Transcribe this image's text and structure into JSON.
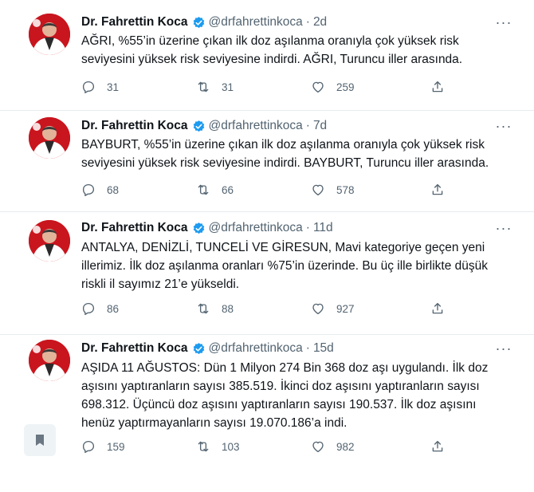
{
  "tweets": [
    {
      "name": "Dr. Fahrettin Koca",
      "handle": "@drfahrettinkoca",
      "dot": "·",
      "time": "2d",
      "text": "AĞRI, %55’in üzerine çıkan ilk doz aşılanma oranıyla çok yüksek risk seviyesini yüksek risk seviyesine indirdi. AĞRI, Turuncu iller arasında.",
      "replies": "31",
      "retweets": "31",
      "likes": "259"
    },
    {
      "name": "Dr. Fahrettin Koca",
      "handle": "@drfahrettinkoca",
      "dot": "·",
      "time": "7d",
      "text": "BAYBURT, %55’in üzerine çıkan ilk doz aşılanma oranıyla çok yüksek risk seviyesini yüksek risk seviyesine indirdi. BAYBURT, Turuncu iller arasında.",
      "replies": "68",
      "retweets": "66",
      "likes": "578"
    },
    {
      "name": "Dr. Fahrettin Koca",
      "handle": "@drfahrettinkoca",
      "dot": "·",
      "time": "11d",
      "text": "ANTALYA, DENİZLİ, TUNCELİ VE GİRESUN, Mavi kategoriye geçen yeni illerimiz. İlk doz aşılanma oranları %75’in üzerinde. Bu üç ille birlikte düşük riskli il sayımız 21’e yükseldi.",
      "replies": "86",
      "retweets": "88",
      "likes": "927"
    },
    {
      "name": "Dr. Fahrettin Koca",
      "handle": "@drfahrettinkoca",
      "dot": "·",
      "time": "15d",
      "text": "AŞIDA 11 AĞUSTOS: Dün 1 Milyon 274 Bin 368 doz aşı uygulandı. İlk doz aşısını yaptıranların sayısı 385.519. İkinci doz aşısını yaptıranların sayısı 698.312. Üçüncü doz aşısını yaptıranların sayısı 190.537. İlk doz aşısını henüz yaptırmayanların sayısı 19.070.186’a indi.",
      "replies": "159",
      "retweets": "103",
      "likes": "982"
    }
  ],
  "icons": {
    "verified": "verified-badge-icon",
    "more": "more-options-icon",
    "reply": "reply-icon",
    "retweet": "retweet-icon",
    "like": "heart-icon",
    "share": "share-icon",
    "bookmark": "bookmark-icon"
  },
  "colors": {
    "verified": "#1d9bf0",
    "muted": "#536471",
    "text": "#0f1419",
    "avatar_bg": "#c9151e"
  }
}
